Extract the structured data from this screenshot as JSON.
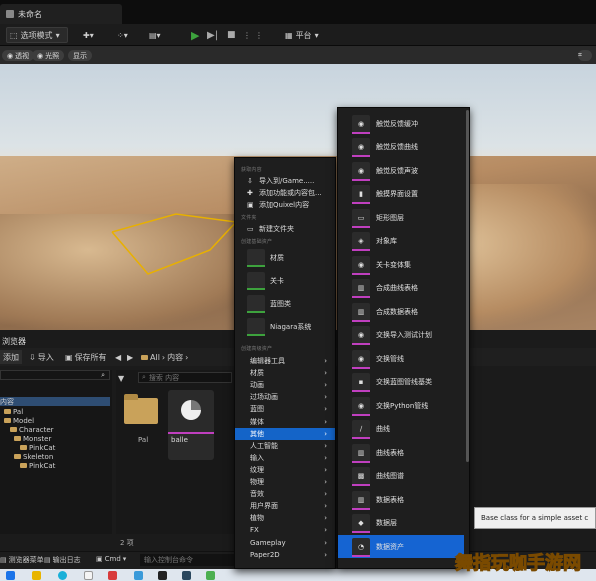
{
  "window": {
    "tab_title": "未命名"
  },
  "toolbar": {
    "mode_label": "选项模式",
    "platform_label": "平台"
  },
  "viewport": {
    "pills": [
      "透视",
      "光照",
      "显示"
    ]
  },
  "content_browser": {
    "tab_label": "浏览器",
    "tools": {
      "add": "添加",
      "import": "导入",
      "save_all": "保存所有"
    },
    "breadcrumb": [
      "All",
      "内容"
    ],
    "search_placeholder": "搜索 内容",
    "tree": [
      {
        "label": "内容",
        "level": 0,
        "selected": true
      },
      {
        "label": "Pal",
        "level": 1
      },
      {
        "label": "Model",
        "level": 1
      },
      {
        "label": "Character",
        "level": 2
      },
      {
        "label": "Monster",
        "level": 3
      },
      {
        "label": "PinkCat",
        "level": 4
      },
      {
        "label": "Skeleton",
        "level": 3
      },
      {
        "label": "PinkCat",
        "level": 4
      }
    ],
    "assets": [
      {
        "label": "Pal",
        "kind": "folder"
      },
      {
        "label": "balle",
        "kind": "asset"
      }
    ],
    "count": "2 项"
  },
  "bottom_bar": {
    "drawer": "测览器菜单",
    "output_log": "输出日志",
    "cmd": "Cmd",
    "console_placeholder": "输入控制台命令"
  },
  "context_menu": {
    "sec_import": "获取内容",
    "import_items": [
      "导入到/Game.....",
      "添加功能或内容包...",
      "添加Quixel内容"
    ],
    "sec_folder": "文件夹",
    "folder_items": [
      "新建文件夹"
    ],
    "sec_basic": "创建基础资产",
    "basic_tiles": [
      "材质",
      "关卡",
      "蓝图类",
      "Niagara系统"
    ],
    "sec_advanced": "创建高级资产",
    "submenus": [
      "编辑器工具",
      "材质",
      "动画",
      "过场动画",
      "蓝图",
      "媒体",
      "其他",
      "人工智能",
      "输入",
      "纹理",
      "物理",
      "音效",
      "用户界面",
      "植物",
      "FX",
      "Gameplay",
      "Paper2D"
    ],
    "selected_submenu": "其他"
  },
  "sub_menu": {
    "items": [
      "触觉反馈缓冲",
      "触觉反馈曲线",
      "触觉反馈声波",
      "触摸界面设置",
      "矩形图层",
      "对象库",
      "关卡变体集",
      "合成曲线表格",
      "合成数据表格",
      "交换导入测试计划",
      "交换管线",
      "交换蓝图管线基类",
      "交换Python管线",
      "曲线",
      "曲线表格",
      "曲线图谱",
      "数据表格",
      "数据层",
      "数据资产"
    ],
    "selected": "数据资产"
  },
  "tooltip": {
    "text": "Base class for a simple asset c"
  },
  "watermark": {
    "text": "舞指玩咖手游网"
  },
  "colors": {
    "accent": "#1464c8",
    "folder": "#c9a25a",
    "play": "#3da23d",
    "misc_strip": "#c03fbf"
  }
}
